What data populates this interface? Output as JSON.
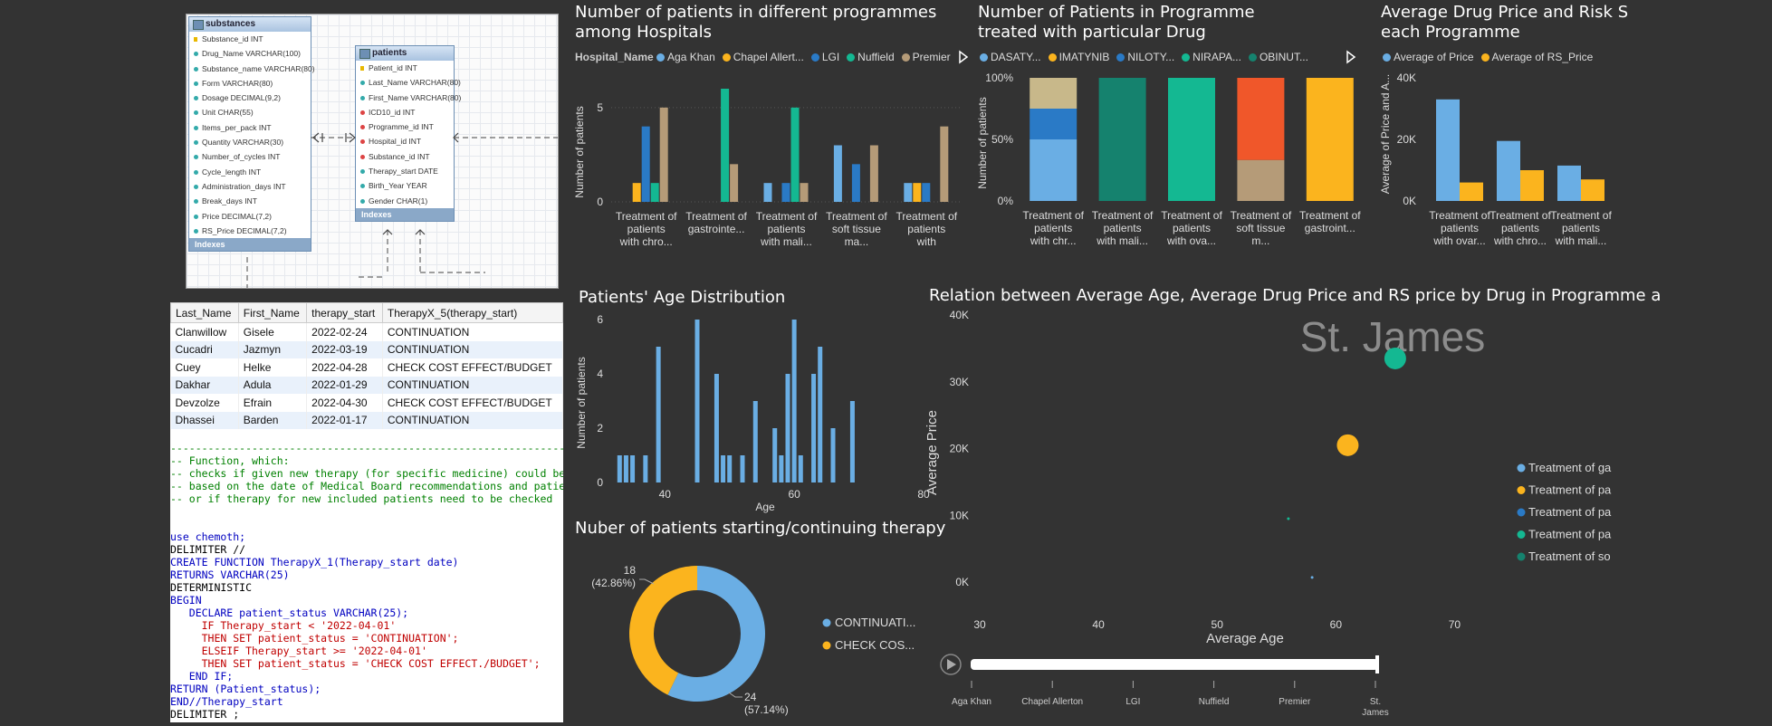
{
  "er_diagram": {
    "substances": {
      "title": "substances",
      "fields": [
        {
          "name": "Substance_id INT",
          "kind": "pk"
        },
        {
          "name": "Drug_Name VARCHAR(100)",
          "kind": "col"
        },
        {
          "name": "Substance_name VARCHAR(80)",
          "kind": "col"
        },
        {
          "name": "Form VARCHAR(80)",
          "kind": "col"
        },
        {
          "name": "Dosage DECIMAL(9,2)",
          "kind": "col"
        },
        {
          "name": "Unit CHAR(55)",
          "kind": "col"
        },
        {
          "name": "Items_per_pack INT",
          "kind": "col"
        },
        {
          "name": "Quantity VARCHAR(30)",
          "kind": "col"
        },
        {
          "name": "Number_of_cycles INT",
          "kind": "col"
        },
        {
          "name": "Cycle_length INT",
          "kind": "col"
        },
        {
          "name": "Administration_days INT",
          "kind": "col"
        },
        {
          "name": "Break_days INT",
          "kind": "col"
        },
        {
          "name": "Price DECIMAL(7,2)",
          "kind": "col"
        },
        {
          "name": "RS_Price DECIMAL(7,2)",
          "kind": "col"
        }
      ],
      "footer": "Indexes"
    },
    "patients": {
      "title": "patients",
      "fields": [
        {
          "name": "Patient_id INT",
          "kind": "pk"
        },
        {
          "name": "Last_Name VARCHAR(80)",
          "kind": "col"
        },
        {
          "name": "First_Name VARCHAR(80)",
          "kind": "col"
        },
        {
          "name": "ICD10_id INT",
          "kind": "fk"
        },
        {
          "name": "Programme_id INT",
          "kind": "fk"
        },
        {
          "name": "Hospital_id INT",
          "kind": "fk"
        },
        {
          "name": "Substance_id INT",
          "kind": "fk"
        },
        {
          "name": "Therapy_start DATE",
          "kind": "col"
        },
        {
          "name": "Birth_Year YEAR",
          "kind": "col"
        },
        {
          "name": "Gender CHAR(1)",
          "kind": "col"
        }
      ],
      "footer": "Indexes"
    }
  },
  "sql_results": {
    "columns": [
      "Last_Name",
      "First_Name",
      "therapy_start",
      "TherapyX_5(therapy_start)"
    ],
    "rows": [
      [
        "Clanwillow",
        "Gisele",
        "2022-02-24",
        "CONTINUATION"
      ],
      [
        "Cucadri",
        "Jazmyn",
        "2022-03-19",
        "CONTINUATION"
      ],
      [
        "Cuey",
        "Helke",
        "2022-04-28",
        "CHECK COST EFFECT/BUDGET"
      ],
      [
        "Dakhar",
        "Adula",
        "2022-01-29",
        "CONTINUATION"
      ],
      [
        "Devzolze",
        "Efrain",
        "2022-04-30",
        "CHECK COST EFFECT/BUDGET"
      ],
      [
        "Dhassei",
        "Barden",
        "2022-01-17",
        "CONTINUATION"
      ]
    ]
  },
  "sql_code": [
    {
      "t": "-------------------------------------------------------------------------------",
      "c": "cm"
    },
    {
      "t": "-- Function, which:",
      "c": "cm"
    },
    {
      "t": "-- checks if given new therapy (for specific medicine) could be",
      "c": "cm"
    },
    {
      "t": "-- based on the date of Medical Board recommendations and patients",
      "c": "cm"
    },
    {
      "t": "-- or if therapy for new included patients need to be checked",
      "c": "cm"
    },
    {
      "t": "",
      "c": ""
    },
    {
      "t": "",
      "c": ""
    },
    {
      "t": "use chemoth;",
      "c": "kw"
    },
    {
      "t": "DELIMITER //",
      "c": ""
    },
    {
      "t": "CREATE FUNCTION TherapyX_1(Therapy_start date)",
      "c": "kw"
    },
    {
      "t": "RETURNS VARCHAR(25)",
      "c": "kw"
    },
    {
      "t": "DETERMINISTIC",
      "c": ""
    },
    {
      "t": "BEGIN",
      "c": "kw"
    },
    {
      "t": "   DECLARE patient_status VARCHAR(25);",
      "c": "kw"
    },
    {
      "t": "     IF Therapy_start < '2022-04-01'",
      "c": "str"
    },
    {
      "t": "     THEN SET patient_status = 'CONTINUATION';",
      "c": "str"
    },
    {
      "t": "     ELSEIF Therapy_start >= '2022-04-01'",
      "c": "str"
    },
    {
      "t": "     THEN SET patient_status = 'CHECK COST EFFECT./BUDGET';",
      "c": "str"
    },
    {
      "t": "   END IF;",
      "c": "kw"
    },
    {
      "t": "RETURN (Patient_status);",
      "c": "kw"
    },
    {
      "t": "END//Therapy_start",
      "c": "kw"
    },
    {
      "t": "DELIMITER ;",
      "c": ""
    }
  ],
  "colors": {
    "aga_khan": "#6aaee4",
    "chapel": "#fbb41e",
    "lgi": "#2a7ac6",
    "nuffield": "#14b892",
    "premier": "#b59b78",
    "st_james": "#15826e",
    "dasaty": "#6aaee4",
    "imatynib": "#c8b88a",
    "niloty": "#2a7ac6",
    "nirapa": "#14b892",
    "obinut": "#f0572a",
    "teal_dark": "#15826e",
    "gold": "#fbb41e"
  },
  "chart_data": [
    {
      "id": "c1",
      "type": "bar",
      "title": "Number of patients in different programmes among Hospitals",
      "legend_title": "Hospital_Name",
      "ylabel": "Number of patients",
      "ylim": [
        0,
        6
      ],
      "yticks": [
        0,
        5
      ],
      "categories": [
        "Treatment of patients with chro...",
        "Treatment of gastrointe...",
        "Treatment of patients with mali...",
        "Treatment of soft tissue ma...",
        "Treatment of patients with ovari..."
      ],
      "series": [
        {
          "name": "Aga Khan",
          "color": "#6aaee4",
          "values": [
            0,
            0,
            1,
            3,
            1
          ]
        },
        {
          "name": "Chapel Allert...",
          "color": "#fbb41e",
          "values": [
            1,
            0,
            0,
            0,
            1
          ]
        },
        {
          "name": "LGI",
          "color": "#2a7ac6",
          "values": [
            4,
            0,
            1,
            2,
            1
          ]
        },
        {
          "name": "Nuffield",
          "color": "#14b892",
          "values": [
            1,
            6,
            5,
            0,
            0
          ]
        },
        {
          "name": "Premier",
          "color": "#b59b78",
          "values": [
            5,
            2,
            1,
            3,
            4
          ]
        }
      ]
    },
    {
      "id": "c2",
      "type": "bar",
      "stacked": "100%",
      "title": "Number of Patients in Programme treated with particular Drug",
      "ylabel": "Number of patients",
      "yticks": [
        "0%",
        "50%",
        "100%"
      ],
      "categories": [
        "Treatment of patients with chr...",
        "Treatment of patients with mali...",
        "Treatment of patients with ova...",
        "Treatment of soft tissue m...",
        "Treatment of gastroint..."
      ],
      "legend": [
        "DASATY...",
        "IMATYNIB",
        "NILOTY...",
        "NIRAPA...",
        "OBINUT..."
      ],
      "stacks": [
        [
          {
            "color": "#6aaee4",
            "share": 0.5
          },
          {
            "color": "#2a7ac6",
            "share": 0.25
          },
          {
            "color": "#c8b88a",
            "share": 0.25
          }
        ],
        [
          {
            "color": "#15826e",
            "share": 1.0
          }
        ],
        [
          {
            "color": "#14b892",
            "share": 1.0
          }
        ],
        [
          {
            "color": "#b59b78",
            "share": 0.333
          },
          {
            "color": "#f0572a",
            "share": 0.667
          }
        ],
        [
          {
            "color": "#fbb41e",
            "share": 1.0
          }
        ]
      ]
    },
    {
      "id": "c3",
      "type": "bar",
      "title": "Average Drug Price and Risk Sharing Price for each Programme",
      "title_visible": [
        "Average Drug Price and Risk S",
        "each Programme"
      ],
      "ylabel": "Average of Price and A...",
      "ylim": [
        0,
        40000
      ],
      "yticks": [
        "0K",
        "20K",
        "40K"
      ],
      "categories": [
        "Treatment of patients with ovar...",
        "Treatment of patients with chro...",
        "Treatment of patients with mali..."
      ],
      "series": [
        {
          "name": "Average of Price",
          "color": "#6aaee4",
          "values": [
            33000,
            19500,
            11500
          ]
        },
        {
          "name": "Average of RS_Price",
          "color": "#fbb41e",
          "values": [
            6000,
            10000,
            7000
          ]
        }
      ]
    },
    {
      "id": "c4",
      "type": "bar",
      "title": "Patients' Age Distribution",
      "xlabel": "Age",
      "ylabel": "Number of patients",
      "xlim": [
        31,
        80
      ],
      "ylim": [
        0,
        6
      ],
      "xticks": [
        40,
        60,
        80
      ],
      "yticks": [
        0,
        2,
        4,
        6
      ],
      "x": [
        33,
        34,
        35,
        37,
        39,
        45,
        48,
        49,
        50,
        52,
        54,
        57,
        58,
        59,
        60,
        61,
        63,
        64,
        66,
        69
      ],
      "values": [
        1,
        1,
        1,
        1,
        5,
        6,
        4,
        1,
        1,
        1,
        3,
        2,
        1,
        4,
        6,
        1,
        4,
        5,
        2,
        3
      ]
    },
    {
      "id": "c5",
      "type": "pie",
      "donut": true,
      "title": "Nuber of patients starting/continuing therapy",
      "slices": [
        {
          "name": "CONTINUATI...",
          "value": 24,
          "label": "24",
          "pct": "(57.14%)",
          "color": "#6aaee4"
        },
        {
          "name": "CHECK COS...",
          "value": 18,
          "label": "18",
          "pct": "(42.86%)",
          "color": "#fbb41e"
        }
      ]
    },
    {
      "id": "c6",
      "type": "scatter",
      "title": "Relation between Average Age, Average Drug Price and RS price by Drug in Programme a",
      "xlabel": "Average Age",
      "ylabel": "Average Price",
      "xlim": [
        30,
        75
      ],
      "ylim": [
        -3000,
        40000
      ],
      "xticks": [
        30,
        40,
        50,
        60,
        70
      ],
      "yticks": [
        [
          "0K",
          0
        ],
        [
          "10K",
          10000
        ],
        [
          "20K",
          20000
        ],
        [
          "30K",
          30000
        ],
        [
          "40K",
          40000
        ]
      ],
      "watermark": "St. James",
      "points": [
        {
          "x": 65.0,
          "y": 33500,
          "size": 12,
          "color": "#14b892"
        },
        {
          "x": 61.0,
          "y": 20500,
          "size": 12,
          "color": "#fbb41e"
        },
        {
          "x": 56.0,
          "y": 9500,
          "size": 1.5,
          "color": "#14b892"
        },
        {
          "x": 58.0,
          "y": 700,
          "size": 1.5,
          "color": "#6aaee4"
        }
      ],
      "legend": [
        {
          "label": "Treatment of ga",
          "color": "#6aaee4"
        },
        {
          "label": "Treatment of pa",
          "color": "#fbb41e"
        },
        {
          "label": "Treatment of pa",
          "color": "#2a7ac6"
        },
        {
          "label": "Treatment of pa",
          "color": "#14b892"
        },
        {
          "label": "Treatment of so",
          "color": "#15826e"
        }
      ],
      "play_axis": [
        "Aga Khan",
        "Chapel Allerton",
        "LGI",
        "Nuffield",
        "Premier",
        "St. James"
      ]
    }
  ]
}
